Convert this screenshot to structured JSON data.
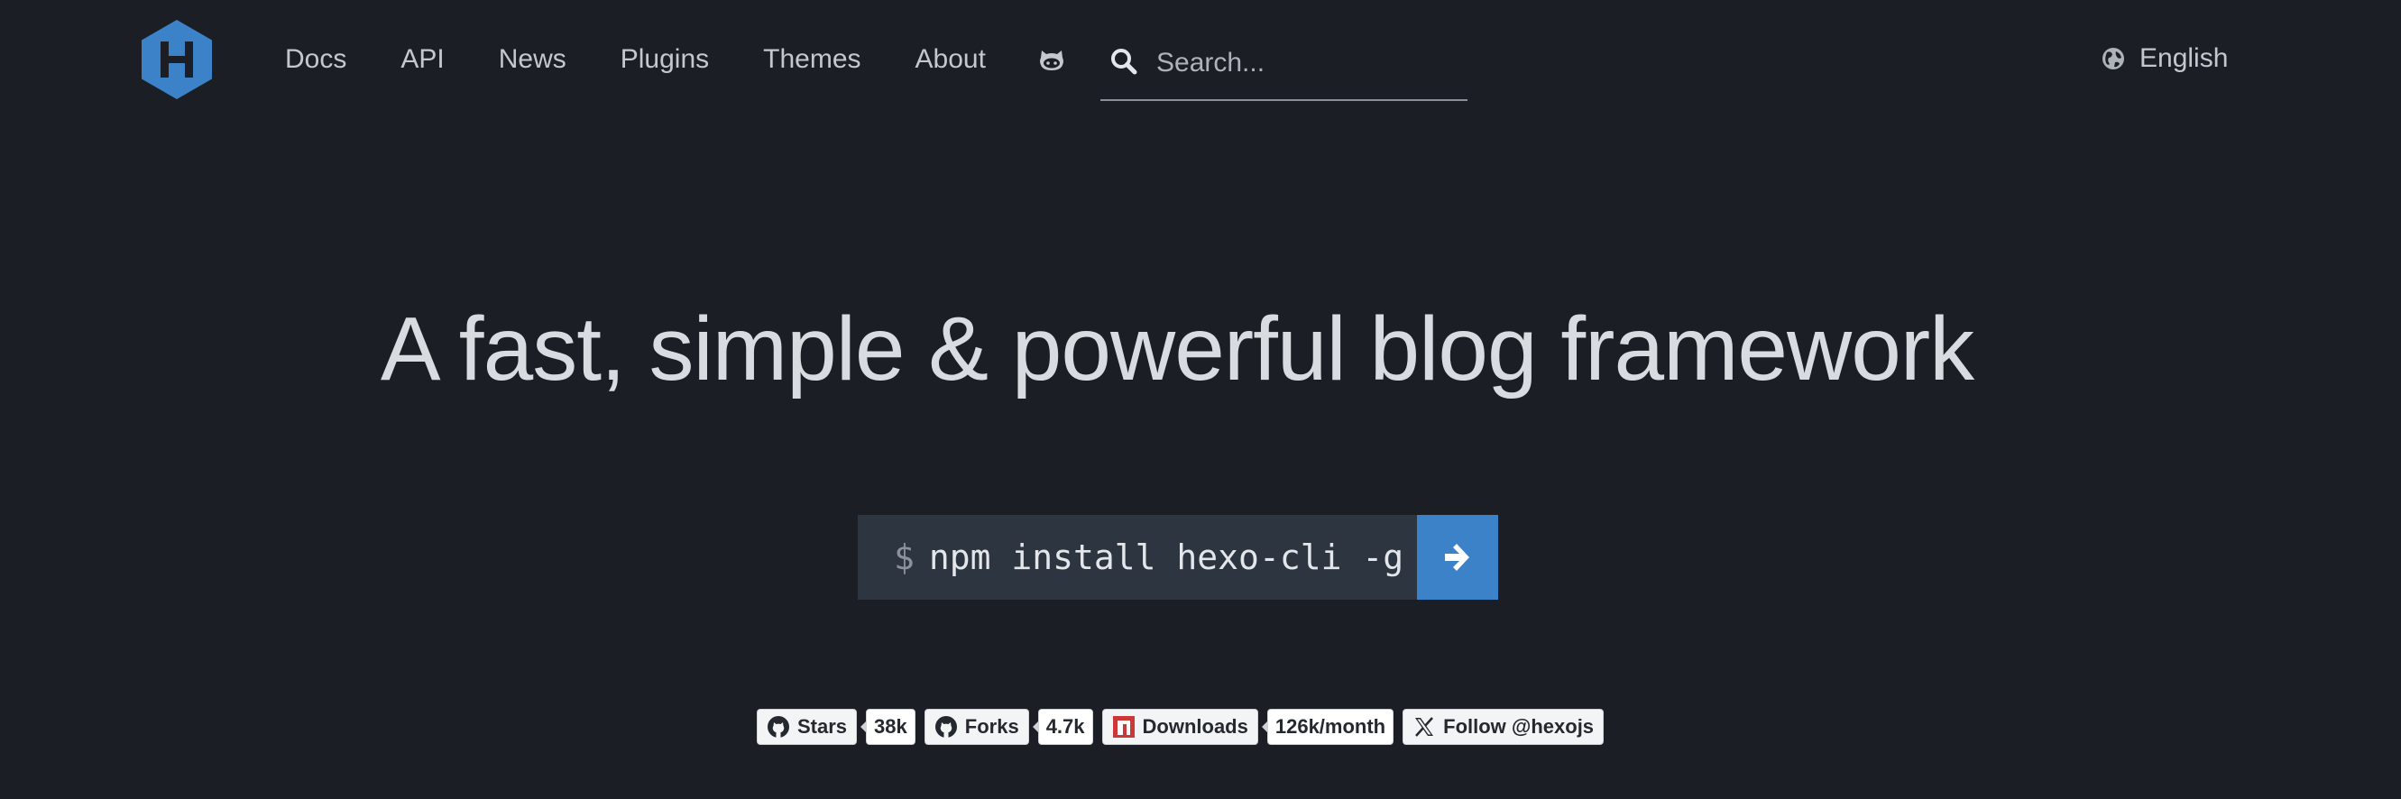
{
  "nav": {
    "logo_alt": "Hexo",
    "links": [
      "Docs",
      "API",
      "News",
      "Plugins",
      "Themes",
      "About"
    ],
    "github_icon": "github-octocat-icon",
    "search_placeholder": "Search...",
    "language": "English"
  },
  "hero": {
    "headline": "A fast, simple & powerful blog framework",
    "prompt": "$",
    "command": "npm install hexo-cli -g"
  },
  "badges": {
    "stars_label": "Stars",
    "stars_count": "38k",
    "forks_label": "Forks",
    "forks_count": "4.7k",
    "downloads_label": "Downloads",
    "downloads_count": "126k/month",
    "follow_label": "Follow @hexojs"
  },
  "colors": {
    "background": "#1b1f25",
    "brand_blue": "#3b82c8",
    "command_bg": "#2d3540"
  }
}
